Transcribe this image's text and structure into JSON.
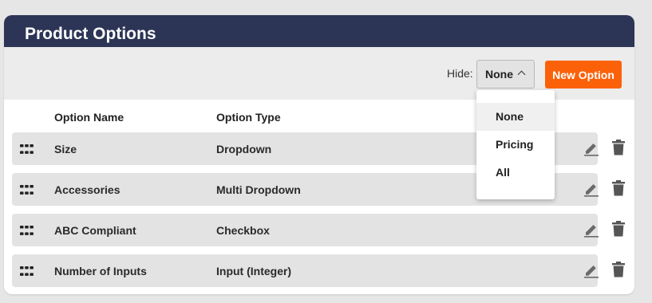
{
  "panel": {
    "title": "Product Options"
  },
  "toolbar": {
    "hide_label": "Hide:",
    "hide_selected": "None",
    "new_option_label": "New Option"
  },
  "columns": {
    "name": "Option Name",
    "type": "Option Type"
  },
  "options": [
    {
      "name": "Size",
      "type": "Dropdown"
    },
    {
      "name": "Accessories",
      "type": "Multi Dropdown"
    },
    {
      "name": "ABC Compliant",
      "type": "Checkbox"
    },
    {
      "name": "Number of Inputs",
      "type": "Input (Integer)"
    }
  ],
  "hide_dropdown": {
    "open": true,
    "options": [
      "None",
      "Pricing",
      "All"
    ],
    "selected": "None"
  },
  "colors": {
    "header_bg": "#2c3556",
    "accent": "#fb6109",
    "row_bg": "#e3e3e3",
    "toolbar_bg": "#ececec"
  },
  "icons": {
    "drag": "drag-handle-icon",
    "edit": "pencil-icon",
    "delete": "trash-icon",
    "chevron": "chevron-up-icon"
  }
}
